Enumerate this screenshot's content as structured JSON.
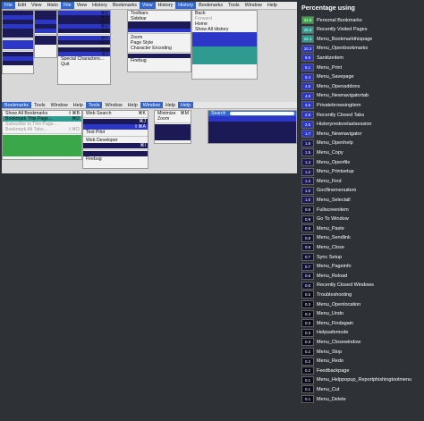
{
  "shot": {
    "menubar1": [
      "File",
      "Edit",
      "View",
      "Histo",
      "File",
      "View",
      "History",
      "Bookmarks",
      "View",
      "History",
      "History",
      "Bookmarks",
      "Tools",
      "Window",
      "Help"
    ],
    "view_menu": {
      "items": [
        {
          "label": "Toolbars",
          "shortcut": ""
        },
        {
          "label": "Sidebar",
          "shortcut": ""
        },
        {
          "label": "Zoom",
          "shortcut": ""
        },
        {
          "label": "Page Style",
          "shortcut": ""
        },
        {
          "label": "Character Encoding",
          "shortcut": ""
        },
        {
          "label": "Firebug",
          "shortcut": ""
        }
      ]
    },
    "history_menu": {
      "items": [
        {
          "label": "Back",
          "shortcut": ""
        },
        {
          "label": "Forward",
          "shortcut": ""
        },
        {
          "label": "Home",
          "shortcut": ""
        },
        {
          "label": "Show All History",
          "shortcut": ""
        }
      ]
    },
    "shortcuts_col": [
      "⌘Z",
      "⌘X",
      "⌘C",
      "⌘V",
      "⌘A",
      "⌘F",
      "⌘G",
      "⌘E",
      "⌘J"
    ],
    "file_items": [
      "Special Characters...",
      "Quit"
    ],
    "menubar2": [
      "Bookmarks",
      "Tools",
      "Window",
      "Help",
      "Tools",
      "Window",
      "Help",
      "Window",
      "Help",
      "Help"
    ],
    "bookmarks_menu": {
      "items": [
        {
          "label": "Show All Bookmarks",
          "shortcut": "⇧⌘B"
        },
        {
          "label": "Bookmark This Page...",
          "shortcut": "⌘D"
        },
        {
          "label": "Subscribe to This Page...",
          "shortcut": ""
        },
        {
          "label": "Bookmark All Tabs...",
          "shortcut": "⇧⌘D"
        }
      ]
    },
    "tools_menu": {
      "items": [
        {
          "label": "Web Search",
          "shortcut": "⌘K"
        },
        {
          "label": "Downloads",
          "shortcut": "⌘J"
        },
        {
          "label": "Add-ons",
          "shortcut": "⇧⌘A"
        },
        {
          "label": "Test Pilot",
          "shortcut": ""
        },
        {
          "label": "Web Developer",
          "shortcut": ""
        },
        {
          "label": "Page Info",
          "shortcut": "⌘I"
        },
        {
          "label": "Firebug",
          "shortcut": ""
        }
      ]
    },
    "window_menu": {
      "items": [
        {
          "label": "Minimize",
          "shortcut": "⌘M"
        },
        {
          "label": "Zoom",
          "shortcut": ""
        }
      ]
    },
    "help_menu": {
      "search_label": "Search"
    }
  },
  "panel": {
    "title": "Percentage using",
    "rows": [
      {
        "pct": "24.9",
        "label": "Personal Bookmarks",
        "color": "#3aa84a"
      },
      {
        "pct": "16.4",
        "label": "Recently Visited Pages",
        "color": "#2f9a8f"
      },
      {
        "pct": "14.1",
        "label": "Menu_Bookmarkthispage",
        "color": "#2f9a8f"
      },
      {
        "pct": "10.2",
        "label": "Menu_Openbookmarks",
        "color": "#2c37c8"
      },
      {
        "pct": "9.9",
        "label": "Sanitizeitem",
        "color": "#2c37c8"
      },
      {
        "pct": "6.1",
        "label": "Menu_Print",
        "color": "#2c37c8"
      },
      {
        "pct": "5.4",
        "label": "Menu_Savepage",
        "color": "#2c37c8"
      },
      {
        "pct": "4.6",
        "label": "Menu_Openaddons",
        "color": "#2c37c8"
      },
      {
        "pct": "4.6",
        "label": "Menu_Newnavigatortab",
        "color": "#2c37c8"
      },
      {
        "pct": "3.5",
        "label": "Privatebrowsingitem",
        "color": "#2c37c8"
      },
      {
        "pct": "2.8",
        "label": "Recently Closed Tabs",
        "color": "#2c37c8"
      },
      {
        "pct": "2.5",
        "label": "Historyrestorelastsession",
        "color": "#2c37c8"
      },
      {
        "pct": "1.7",
        "label": "Menu_Newnavigator",
        "color": "#2c37c8"
      },
      {
        "pct": "1.6",
        "label": "Menu_Openhelp",
        "color": "#1c1a56"
      },
      {
        "pct": "1.5",
        "label": "Menu_Copy",
        "color": "#1c1a56"
      },
      {
        "pct": "1.4",
        "label": "Menu_Openfile",
        "color": "#1c1a56"
      },
      {
        "pct": "1.2",
        "label": "Menu_Printsetup",
        "color": "#1c1a56"
      },
      {
        "pct": "1.2",
        "label": "Menu_Find",
        "color": "#1c1a56"
      },
      {
        "pct": "1.0",
        "label": "Gocflinemenuitem",
        "color": "#1c1a56"
      },
      {
        "pct": "1.0",
        "label": "Menu_Selectall",
        "color": "#1c1a56"
      },
      {
        "pct": "0.9",
        "label": "Fullscreenitem",
        "color": "#131235"
      },
      {
        "pct": "0.9",
        "label": "Go To Window",
        "color": "#131235"
      },
      {
        "pct": "0.8",
        "label": "Menu_Paste",
        "color": "#131235"
      },
      {
        "pct": "0.8",
        "label": "Menu_Sendlink",
        "color": "#131235"
      },
      {
        "pct": "0.8",
        "label": "Menu_Close",
        "color": "#131235"
      },
      {
        "pct": "0.7",
        "label": "Sync Setup",
        "color": "#131235"
      },
      {
        "pct": "0.7",
        "label": "Menu_Pageinfo",
        "color": "#131235"
      },
      {
        "pct": "0.6",
        "label": "Menu_Reload",
        "color": "#131235"
      },
      {
        "pct": "0.6",
        "label": "Recently Closed Windows",
        "color": "#131235"
      },
      {
        "pct": "0.5",
        "label": "Troubleshooting",
        "color": "#0a0a1a"
      },
      {
        "pct": "0.3",
        "label": "Menu_Openlocation",
        "color": "#0a0a1a"
      },
      {
        "pct": "0.3",
        "label": "Menu_Undo",
        "color": "#0a0a1a"
      },
      {
        "pct": "0.3",
        "label": "Menu_Findagain",
        "color": "#0a0a1a"
      },
      {
        "pct": "0.3",
        "label": "Helpsafemode",
        "color": "#0a0a1a"
      },
      {
        "pct": "0.3",
        "label": "Menu_Closewindow",
        "color": "#0a0a1a"
      },
      {
        "pct": "0.2",
        "label": "Menu_Stop",
        "color": "#0a0a1a"
      },
      {
        "pct": "0.2",
        "label": "Menu_Redo",
        "color": "#0a0a1a"
      },
      {
        "pct": "0.2",
        "label": "Feedbackpage",
        "color": "#0a0a1a"
      },
      {
        "pct": "0.1",
        "label": "Menu_Helppopup_Reportphishingtoolmenu",
        "color": "#0a0a1a"
      },
      {
        "pct": "0.1",
        "label": "Menu_Cut",
        "color": "#0a0a1a"
      },
      {
        "pct": "0.1",
        "label": "Menu_Delete",
        "color": "#0a0a1a"
      }
    ]
  }
}
